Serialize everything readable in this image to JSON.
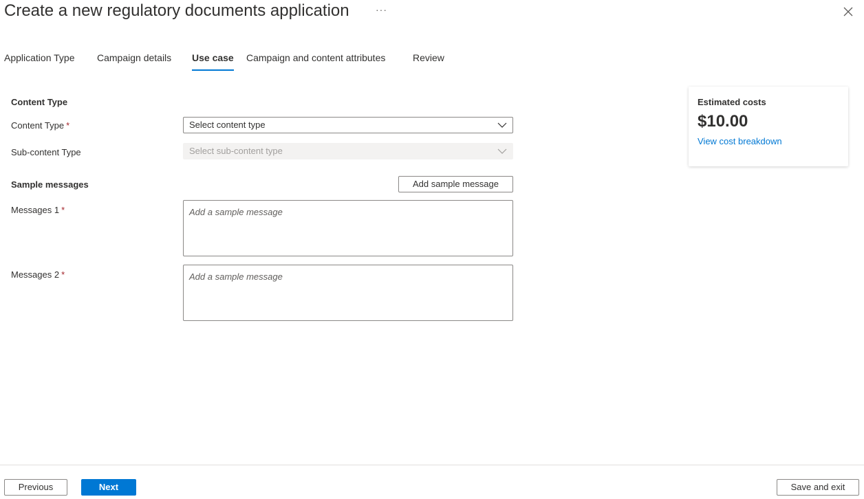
{
  "header": {
    "title": "Create a new regulatory documents application",
    "more_label": "···"
  },
  "tabs": [
    {
      "label": "Application Type",
      "active": false
    },
    {
      "label": "Campaign details",
      "active": false
    },
    {
      "label": "Use case",
      "active": true
    },
    {
      "label": "Campaign and content attributes",
      "active": false
    },
    {
      "label": "Review",
      "active": false
    }
  ],
  "content_type_section": {
    "heading": "Content Type",
    "content_type_label": "Content Type",
    "content_type_placeholder": "Select content type",
    "sub_content_type_label": "Sub-content Type",
    "sub_content_type_placeholder": "Select sub-content type"
  },
  "sample_messages": {
    "heading": "Sample messages",
    "add_button_label": "Add sample message",
    "messages": [
      {
        "label": "Messages 1",
        "placeholder": "Add a sample message"
      },
      {
        "label": "Messages 2",
        "placeholder": "Add a sample message"
      }
    ]
  },
  "required_marker": "*",
  "cost_card": {
    "heading": "Estimated costs",
    "amount": "$10.00",
    "link": "View cost breakdown"
  },
  "footer": {
    "previous_label": "Previous",
    "next_label": "Next",
    "save_exit_label": "Save and exit"
  },
  "colors": {
    "accent": "#0078d4",
    "required": "#a4262c",
    "disabled_bg": "#f3f2f1"
  }
}
